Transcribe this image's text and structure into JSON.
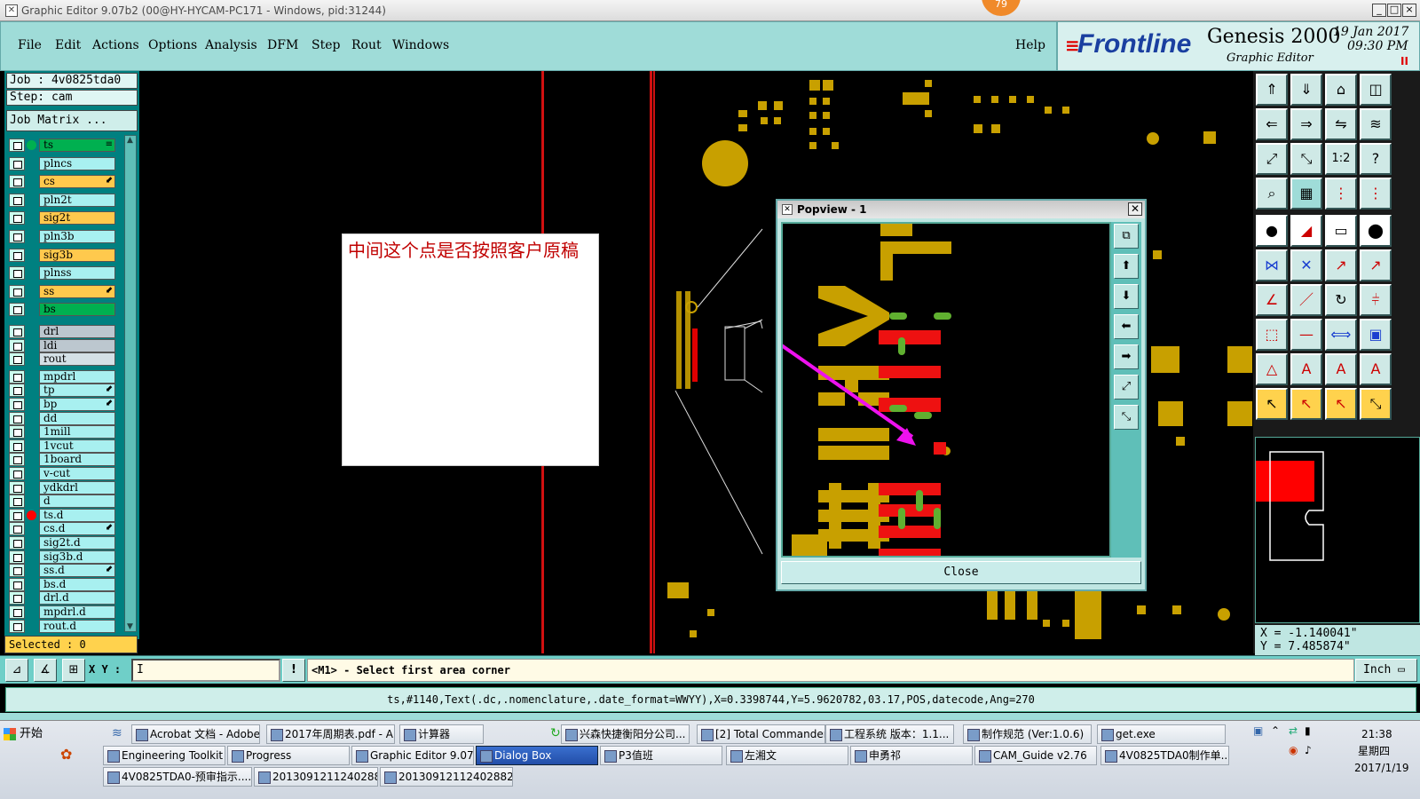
{
  "window": {
    "title": "Graphic Editor 9.07b2 (00@HY-HYCAM-PC171 - Windows, pid:31244)",
    "badge": "79"
  },
  "menu": {
    "items": [
      "File",
      "Edit",
      "Actions",
      "Options",
      "Analysis",
      "DFM",
      "Step",
      "Rout",
      "Windows"
    ],
    "help": "Help"
  },
  "brand": {
    "logo": "Frontline",
    "product": "Genesis 2000",
    "subtitle": "Graphic Editor",
    "date": "19 Jan 2017",
    "time": "09:30 PM",
    "pause": "II"
  },
  "job": {
    "job_label": "Job : 4v0825tda0",
    "step_label": "Step: cam",
    "matrix_button": "Job Matrix ..."
  },
  "layers": [
    {
      "name": "ts",
      "color": "#00b050",
      "dot": "#00b050",
      "arrow": "≡"
    },
    {
      "name": "plncs",
      "color": "#a8f0f0"
    },
    {
      "name": "cs",
      "color": "#ffc94d",
      "arrow": "⬋"
    },
    {
      "name": "pln2t",
      "color": "#a8f0f0"
    },
    {
      "name": "sig2t",
      "color": "#ffc94d"
    },
    {
      "name": "pln3b",
      "color": "#a8f0f0"
    },
    {
      "name": "sig3b",
      "color": "#ffc94d"
    },
    {
      "name": "plnss",
      "color": "#a8f0f0"
    },
    {
      "name": "ss",
      "color": "#ffc94d",
      "arrow": "⬋"
    },
    {
      "name": "bs",
      "color": "#00b050"
    },
    {
      "name": "drl",
      "color": "#bcc7cf"
    },
    {
      "name": "ldi",
      "color": "#bcc7cf"
    },
    {
      "name": "rout",
      "color": "#d4e0e6"
    },
    {
      "name": "mpdrl",
      "color": "#a8f0f0"
    },
    {
      "name": "tp",
      "color": "#a8f0f0",
      "arrow": "⬋"
    },
    {
      "name": "bp",
      "color": "#a8f0f0",
      "arrow": "⬋"
    },
    {
      "name": "dd",
      "color": "#a8f0f0"
    },
    {
      "name": "1mill",
      "color": "#a8f0f0"
    },
    {
      "name": "1vcut",
      "color": "#a8f0f0"
    },
    {
      "name": "1board",
      "color": "#a8f0f0"
    },
    {
      "name": "v-cut",
      "color": "#a8f0f0"
    },
    {
      "name": "ydkdrl",
      "color": "#a8f0f0"
    },
    {
      "name": "d",
      "color": "#a8f0f0"
    },
    {
      "name": "ts.d",
      "color": "#a8f0f0",
      "dot": "#ff0000"
    },
    {
      "name": "cs.d",
      "color": "#a8f0f0",
      "arrow": "⬋"
    },
    {
      "name": "sig2t.d",
      "color": "#a8f0f0"
    },
    {
      "name": "sig3b.d",
      "color": "#a8f0f0"
    },
    {
      "name": "ss.d",
      "color": "#a8f0f0",
      "arrow": "⬋"
    },
    {
      "name": "bs.d",
      "color": "#a8f0f0"
    },
    {
      "name": "drl.d",
      "color": "#a8f0f0"
    },
    {
      "name": "mpdrl.d",
      "color": "#a8f0f0"
    },
    {
      "name": "rout.d",
      "color": "#a8f0f0"
    }
  ],
  "selected_label": "Selected : 0",
  "note": {
    "text": "中间这个点是否按照客户原稿"
  },
  "popview": {
    "title": "Popview - 1",
    "close_label": "Close",
    "tool_icons": [
      "⧉",
      "⬆",
      "⬇",
      "⬅",
      "➡",
      "⤢",
      "⤡"
    ]
  },
  "coords": {
    "x": "X = -1.140041\"",
    "y": "Y = 7.485874\""
  },
  "command": {
    "xy_label": "X Y :",
    "xy_value": "I",
    "info_icon": "!",
    "prompt": "<M1> - Select first area corner",
    "unit": "Inch ▭"
  },
  "status_line": "ts,#1140,Text(.dc,.nomenclature,.date_format=WWYY),X=0.3398744,Y=5.9620782,03.17,POS,datecode,Ang=270",
  "taskbar": {
    "start": "开始",
    "row1": [
      "Acrobat 文档 - Adobe ...",
      "2017年周期表.pdf - A...",
      "计算器",
      "兴森快捷衡阳分公司...",
      "[2] Total Commander 7...",
      "工程系统  版本：1.1...",
      "制作规范 (Ver:1.0.6)",
      "get.exe"
    ],
    "row2": [
      "Engineering Toolkit 9....",
      "Progress",
      "Graphic Editor 9.07...",
      "Dialog Box",
      "P3值班",
      "左湘文",
      "申勇祁",
      "CAM_Guide v2.76",
      "4V0825TDA0制作单...."
    ],
    "row3": [
      "4V0825TDA0-预审指示....",
      "20130912112402882.rtf...",
      "20130912112402882.rtf..."
    ],
    "clock": {
      "time": "21:38",
      "weekday": "星期四",
      "date": "2017/1/19"
    }
  }
}
